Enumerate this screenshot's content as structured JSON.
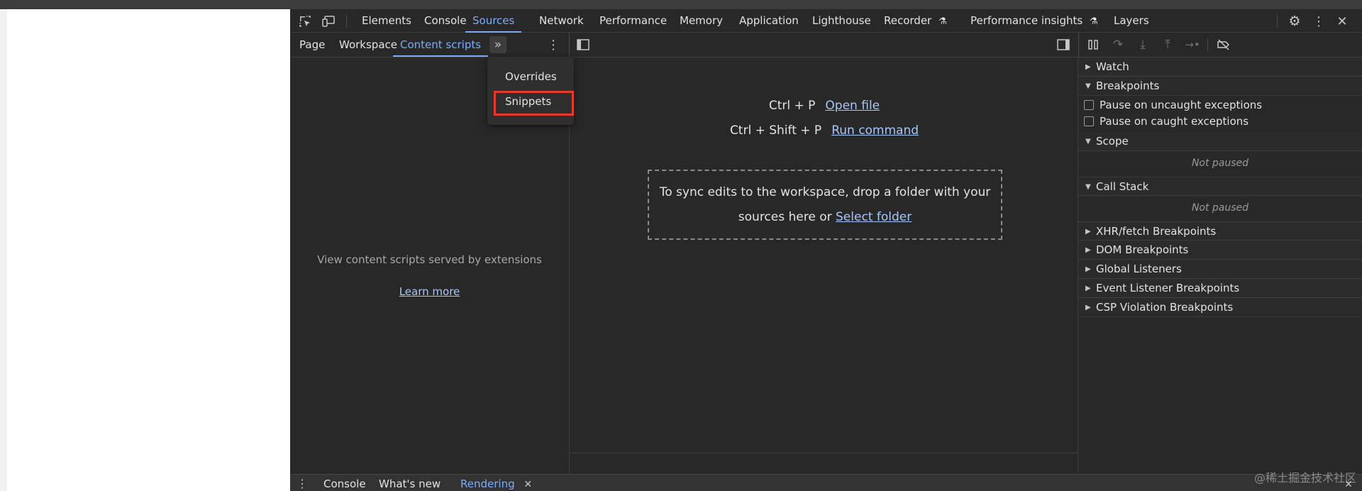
{
  "devtools": {
    "main_tabs": [
      "Elements",
      "Console",
      "Sources",
      "Network",
      "Performance",
      "Memory",
      "Application",
      "Lighthouse",
      "Recorder",
      "Performance insights",
      "Layers"
    ],
    "active_main_tab": "Sources",
    "experimental_icon": "flask-icon"
  },
  "sources": {
    "sub_tabs": [
      "Page",
      "Workspace",
      "Content scripts"
    ],
    "active_sub_tab": "Content scripts",
    "more_tabs_icon": "double-chevron-right-icon",
    "more_tabs_menu": [
      "Overrides",
      "Snippets"
    ],
    "highlighted_menu_item": "Snippets",
    "nav_empty_text": "View content scripts served by extensions",
    "nav_learn_more": "Learn more",
    "editor": {
      "shortcut1_keys": "Ctrl + P",
      "shortcut1_action": "Open file",
      "shortcut2_keys": "Ctrl + Shift + P",
      "shortcut2_action": "Run command",
      "drop_text_line1": "To sync edits to the workspace, drop a folder with your",
      "drop_text_line2": "sources here or",
      "select_folder": "Select folder"
    },
    "debugger": {
      "watch": "Watch",
      "breakpoints": "Breakpoints",
      "pause_uncaught": "Pause on uncaught exceptions",
      "pause_caught": "Pause on caught exceptions",
      "scope": "Scope",
      "scope_status": "Not paused",
      "call_stack": "Call Stack",
      "call_stack_status": "Not paused",
      "xhr": "XHR/fetch Breakpoints",
      "dom": "DOM Breakpoints",
      "global": "Global Listeners",
      "event": "Event Listener Breakpoints",
      "csp": "CSP Violation Breakpoints"
    }
  },
  "drawer": {
    "tabs": [
      "Console",
      "What's new",
      "Rendering"
    ],
    "active_tab": "Rendering"
  },
  "watermark": "@稀土掘金技术社区",
  "colors": {
    "accent": "#7cacf8",
    "highlight": "#e6392b",
    "panel": "#282828"
  }
}
